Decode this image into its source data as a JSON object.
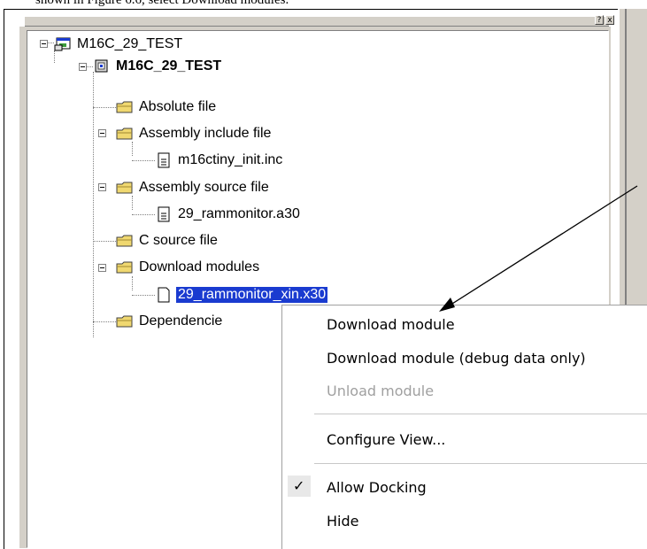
{
  "caption": "shown in Figure 6.6, select Download modules.",
  "panel_buttons": [
    "?",
    "x"
  ],
  "tree": {
    "root": "M16C_29_TEST",
    "project": "M16C_29_TEST",
    "absolute_file": "Absolute file",
    "asm_include": "Assembly include file",
    "asm_include_file": "m16ctiny_init.inc",
    "asm_source": "Assembly source file",
    "asm_source_file": "29_rammonitor.a30",
    "c_source": "C source file",
    "download_modules": "Download modules",
    "download_module_file": "29_rammonitor_xin.x30",
    "dependencies": "Dependencie"
  },
  "context_menu": {
    "download_module": "Download module",
    "download_debug": "Download module (debug data only)",
    "unload_module": "Unload module",
    "configure_view": "Configure View...",
    "allow_docking": "Allow Docking",
    "hide": "Hide",
    "check_mark": "✓"
  },
  "colors": {
    "selection": "#1a3bd0",
    "folder": "#f0d870",
    "window_face": "#d4d0c8"
  }
}
